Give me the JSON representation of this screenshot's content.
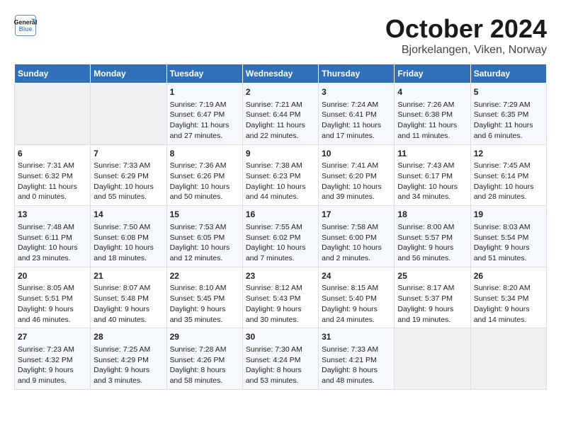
{
  "logo": {
    "line1": "General",
    "line2": "Blue"
  },
  "title": "October 2024",
  "subtitle": "Bjorkelangen, Viken, Norway",
  "header_color": "#3070b8",
  "days_of_week": [
    "Sunday",
    "Monday",
    "Tuesday",
    "Wednesday",
    "Thursday",
    "Friday",
    "Saturday"
  ],
  "weeks": [
    [
      {
        "day": "",
        "content": ""
      },
      {
        "day": "",
        "content": ""
      },
      {
        "day": "1",
        "content": "Sunrise: 7:19 AM\nSunset: 6:47 PM\nDaylight: 11 hours\nand 27 minutes."
      },
      {
        "day": "2",
        "content": "Sunrise: 7:21 AM\nSunset: 6:44 PM\nDaylight: 11 hours\nand 22 minutes."
      },
      {
        "day": "3",
        "content": "Sunrise: 7:24 AM\nSunset: 6:41 PM\nDaylight: 11 hours\nand 17 minutes."
      },
      {
        "day": "4",
        "content": "Sunrise: 7:26 AM\nSunset: 6:38 PM\nDaylight: 11 hours\nand 11 minutes."
      },
      {
        "day": "5",
        "content": "Sunrise: 7:29 AM\nSunset: 6:35 PM\nDaylight: 11 hours\nand 6 minutes."
      }
    ],
    [
      {
        "day": "6",
        "content": "Sunrise: 7:31 AM\nSunset: 6:32 PM\nDaylight: 11 hours\nand 0 minutes."
      },
      {
        "day": "7",
        "content": "Sunrise: 7:33 AM\nSunset: 6:29 PM\nDaylight: 10 hours\nand 55 minutes."
      },
      {
        "day": "8",
        "content": "Sunrise: 7:36 AM\nSunset: 6:26 PM\nDaylight: 10 hours\nand 50 minutes."
      },
      {
        "day": "9",
        "content": "Sunrise: 7:38 AM\nSunset: 6:23 PM\nDaylight: 10 hours\nand 44 minutes."
      },
      {
        "day": "10",
        "content": "Sunrise: 7:41 AM\nSunset: 6:20 PM\nDaylight: 10 hours\nand 39 minutes."
      },
      {
        "day": "11",
        "content": "Sunrise: 7:43 AM\nSunset: 6:17 PM\nDaylight: 10 hours\nand 34 minutes."
      },
      {
        "day": "12",
        "content": "Sunrise: 7:45 AM\nSunset: 6:14 PM\nDaylight: 10 hours\nand 28 minutes."
      }
    ],
    [
      {
        "day": "13",
        "content": "Sunrise: 7:48 AM\nSunset: 6:11 PM\nDaylight: 10 hours\nand 23 minutes."
      },
      {
        "day": "14",
        "content": "Sunrise: 7:50 AM\nSunset: 6:08 PM\nDaylight: 10 hours\nand 18 minutes."
      },
      {
        "day": "15",
        "content": "Sunrise: 7:53 AM\nSunset: 6:05 PM\nDaylight: 10 hours\nand 12 minutes."
      },
      {
        "day": "16",
        "content": "Sunrise: 7:55 AM\nSunset: 6:02 PM\nDaylight: 10 hours\nand 7 minutes."
      },
      {
        "day": "17",
        "content": "Sunrise: 7:58 AM\nSunset: 6:00 PM\nDaylight: 10 hours\nand 2 minutes."
      },
      {
        "day": "18",
        "content": "Sunrise: 8:00 AM\nSunset: 5:57 PM\nDaylight: 9 hours\nand 56 minutes."
      },
      {
        "day": "19",
        "content": "Sunrise: 8:03 AM\nSunset: 5:54 PM\nDaylight: 9 hours\nand 51 minutes."
      }
    ],
    [
      {
        "day": "20",
        "content": "Sunrise: 8:05 AM\nSunset: 5:51 PM\nDaylight: 9 hours\nand 46 minutes."
      },
      {
        "day": "21",
        "content": "Sunrise: 8:07 AM\nSunset: 5:48 PM\nDaylight: 9 hours\nand 40 minutes."
      },
      {
        "day": "22",
        "content": "Sunrise: 8:10 AM\nSunset: 5:45 PM\nDaylight: 9 hours\nand 35 minutes."
      },
      {
        "day": "23",
        "content": "Sunrise: 8:12 AM\nSunset: 5:43 PM\nDaylight: 9 hours\nand 30 minutes."
      },
      {
        "day": "24",
        "content": "Sunrise: 8:15 AM\nSunset: 5:40 PM\nDaylight: 9 hours\nand 24 minutes."
      },
      {
        "day": "25",
        "content": "Sunrise: 8:17 AM\nSunset: 5:37 PM\nDaylight: 9 hours\nand 19 minutes."
      },
      {
        "day": "26",
        "content": "Sunrise: 8:20 AM\nSunset: 5:34 PM\nDaylight: 9 hours\nand 14 minutes."
      }
    ],
    [
      {
        "day": "27",
        "content": "Sunrise: 7:23 AM\nSunset: 4:32 PM\nDaylight: 9 hours\nand 9 minutes."
      },
      {
        "day": "28",
        "content": "Sunrise: 7:25 AM\nSunset: 4:29 PM\nDaylight: 9 hours\nand 3 minutes."
      },
      {
        "day": "29",
        "content": "Sunrise: 7:28 AM\nSunset: 4:26 PM\nDaylight: 8 hours\nand 58 minutes."
      },
      {
        "day": "30",
        "content": "Sunrise: 7:30 AM\nSunset: 4:24 PM\nDaylight: 8 hours\nand 53 minutes."
      },
      {
        "day": "31",
        "content": "Sunrise: 7:33 AM\nSunset: 4:21 PM\nDaylight: 8 hours\nand 48 minutes."
      },
      {
        "day": "",
        "content": ""
      },
      {
        "day": "",
        "content": ""
      }
    ]
  ]
}
